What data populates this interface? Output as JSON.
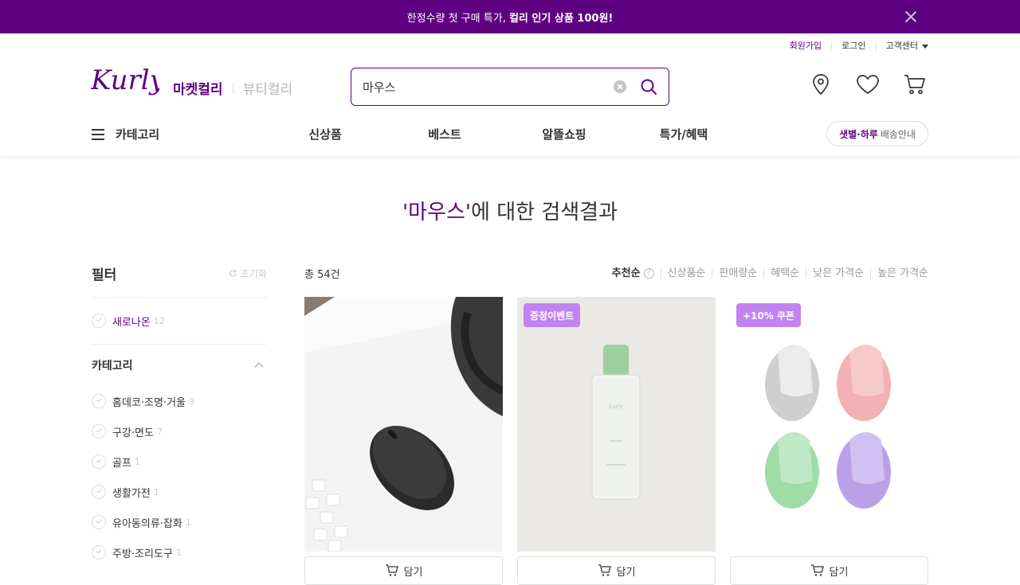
{
  "banner": {
    "text_normal": "한정수량 첫 구매 특가, ",
    "text_bold": "컬리 인기 상품 100원!"
  },
  "util": {
    "signup": "회원가입",
    "login": "로그인",
    "customer_center": "고객센터"
  },
  "logo_text": "Kurly",
  "services": {
    "market": "마켓컬리",
    "beauty": "뷰티컬리"
  },
  "search": {
    "value": "마우스"
  },
  "gnb": {
    "category": "카테고리",
    "menu": [
      "신상품",
      "베스트",
      "알뜰쇼핑",
      "특가/혜택"
    ],
    "delivery_bold": "샛별·하루",
    "delivery_text": "배송안내"
  },
  "result": {
    "quote_open": "'",
    "keyword": "마우스",
    "quote_close": "'",
    "suffix": "에 대한 검색결과"
  },
  "filter": {
    "title": "필터",
    "reset": "초기화",
    "new": {
      "label": "새로나온",
      "count": "12"
    },
    "category_title": "카테고리",
    "categories": [
      {
        "label": "홈데코·조명·거울",
        "count": "9"
      },
      {
        "label": "구강·면도",
        "count": "7"
      },
      {
        "label": "골프",
        "count": "1"
      },
      {
        "label": "생활가전",
        "count": "1"
      },
      {
        "label": "유아동의류·잡화",
        "count": "1"
      },
      {
        "label": "주방·조리도구",
        "count": "1"
      }
    ]
  },
  "list": {
    "total": "총 54건",
    "sorts": [
      "추천순",
      "신상품순",
      "판매량순",
      "혜택순",
      "낮은 가격순",
      "높은 가격순"
    ]
  },
  "products": [
    {
      "tag": "",
      "cart": "담기"
    },
    {
      "tag": "증정이벤트",
      "cart": "담기"
    },
    {
      "tag": "+10% 쿠폰",
      "cart": "담기"
    }
  ],
  "colors": {
    "brand": "#5f0080",
    "tag": "#c183f0"
  }
}
